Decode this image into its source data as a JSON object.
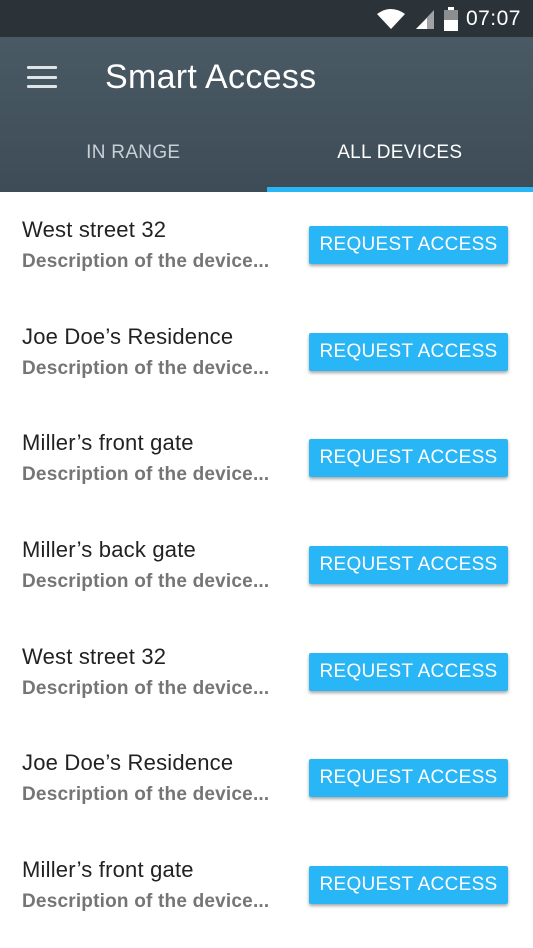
{
  "status_bar": {
    "time": "07:07",
    "icons": [
      "wifi-icon",
      "signal-icon",
      "battery-icon"
    ]
  },
  "app_bar": {
    "menu_icon": "hamburger-menu-icon",
    "title": "Smart Access"
  },
  "tabs": [
    {
      "label": "IN RANGE",
      "active": false
    },
    {
      "label": "ALL DEVICES",
      "active": true
    }
  ],
  "devices": [
    {
      "name": "West street 32",
      "description": "Description of the device...",
      "action": "REQUEST ACCESS"
    },
    {
      "name": "Joe Doe’s Residence",
      "description": "Description of the device...",
      "action": "REQUEST ACCESS"
    },
    {
      "name": "Miller’s front gate",
      "description": "Description of the device...",
      "action": "REQUEST ACCESS"
    },
    {
      "name": "Miller’s back gate",
      "description": "Description of the device...",
      "action": "REQUEST ACCESS"
    },
    {
      "name": "West street 32",
      "description": "Description of the device...",
      "action": "REQUEST ACCESS"
    },
    {
      "name": "Joe Doe’s Residence",
      "description": "Description of the device...",
      "action": "REQUEST ACCESS"
    },
    {
      "name": "Miller’s front gate",
      "description": "Description of the device...",
      "action": "REQUEST ACCESS"
    }
  ],
  "colors": {
    "status_bar": "#2c3338",
    "app_bar": "#455660",
    "accent": "#29b6f6",
    "text_primary": "#222222",
    "text_secondary": "#757575"
  }
}
